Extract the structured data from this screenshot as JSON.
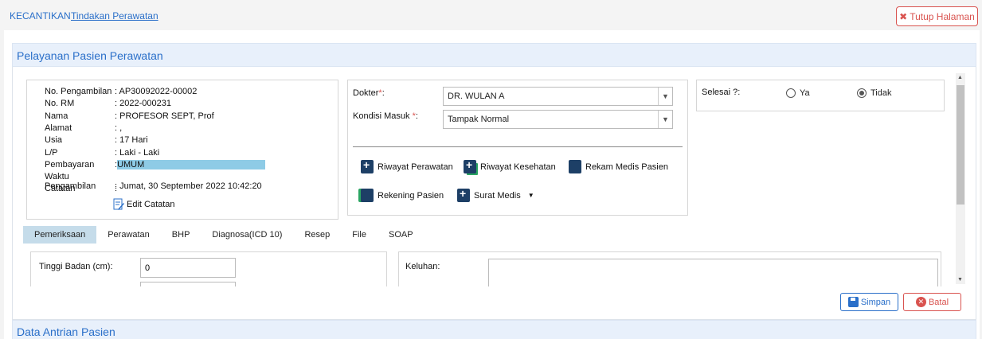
{
  "breadcrumb": {
    "section": "KECANTIKAN",
    "page": "Tindakan Perawatan"
  },
  "close_button": {
    "label": "Tutup Halaman"
  },
  "panel": {
    "title": "Pelayanan Pasien Perawatan"
  },
  "patient": [
    {
      "label": "No. Pengambilan",
      "value": ": AP30092022-00002"
    },
    {
      "label": "No. RM",
      "value": ": 2022-000231"
    },
    {
      "label": "Nama",
      "value": ": PROFESOR SEPT, Prof"
    },
    {
      "label": "Alamat",
      "value": ": ,"
    },
    {
      "label": "Usia",
      "value": ": 17 Hari"
    },
    {
      "label": "L/P",
      "value": ": Laki - Laki"
    },
    {
      "label": "Pembayaran",
      "value": ":",
      "highlight": "UMUM"
    },
    {
      "label": "Waktu Pengambilan",
      "value": ": Jumat, 30 September 2022 10:42:20"
    },
    {
      "label": "Catatan",
      "value": ":"
    }
  ],
  "edit_note": {
    "label": "Edit Catatan"
  },
  "doctor": {
    "label": "Dokter",
    "required": "*",
    "colon": ":",
    "value": "DR. WULAN A"
  },
  "condition": {
    "label": "Kondisi Masuk ",
    "required": "*",
    "colon": ":",
    "value": "Tampak Normal"
  },
  "actions": {
    "treatment_history": "Riwayat Perawatan",
    "health_history": "Riwayat Kesehatan",
    "medical_record": "Rekam Medis Pasien",
    "patient_bill": "Rekening Pasien",
    "medical_letter": "Surat Medis"
  },
  "done": {
    "label": "Selesai ?:",
    "yes": "Ya",
    "no": "Tidak",
    "selected": "Tidak"
  },
  "tabs": [
    "Pemeriksaan",
    "Perawatan",
    "BHP",
    "Diagnosa(ICD 10)",
    "Resep",
    "File",
    "SOAP"
  ],
  "active_tab": "Pemeriksaan",
  "exam": {
    "height_label": "Tinggi Badan (cm):",
    "height_value": "0",
    "complaint_label": "Keluhan:"
  },
  "buttons": {
    "save": "Simpan",
    "cancel": "Batal"
  },
  "queue": {
    "title": "Data Antrian Pasien"
  },
  "colors": {
    "accent": "#2a6fc9",
    "danger": "#d9534f",
    "icon_navy": "#1d3f66",
    "tab_active": "#c5dcea",
    "highlight": "#8ecbe6"
  }
}
